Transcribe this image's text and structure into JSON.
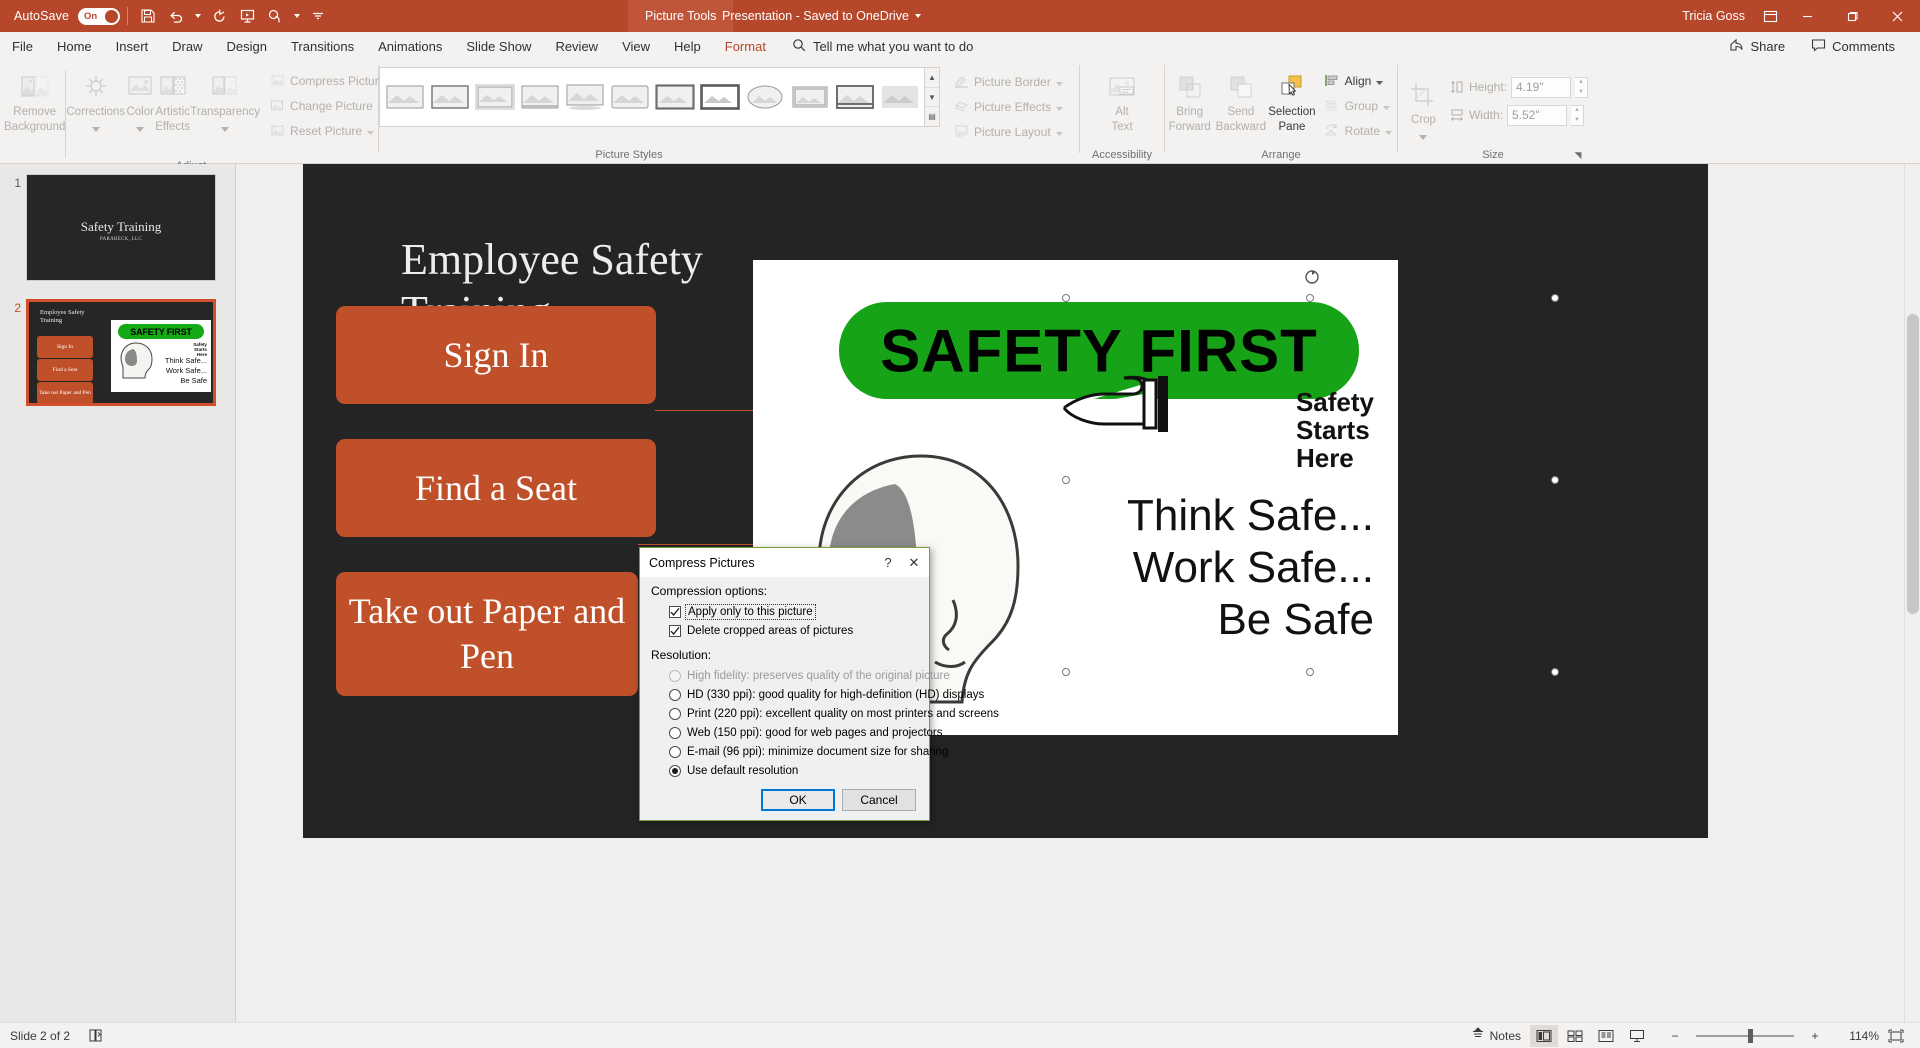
{
  "titlebar": {
    "autosave_label": "AutoSave",
    "autosave_state": "On",
    "qat_icons": [
      "save-icon",
      "undo-icon",
      "redo-icon",
      "start-presentation-icon",
      "touch-mode-icon"
    ],
    "context_tab": "Picture Tools",
    "doc_title": "Presentation  -  Saved to OneDrive",
    "user_name": "Tricia Goss",
    "window_buttons": [
      "minimize",
      "restore",
      "close"
    ]
  },
  "tabs": [
    {
      "label": "File",
      "active": false
    },
    {
      "label": "Home",
      "active": false
    },
    {
      "label": "Insert",
      "active": false
    },
    {
      "label": "Draw",
      "active": false
    },
    {
      "label": "Design",
      "active": false
    },
    {
      "label": "Transitions",
      "active": false
    },
    {
      "label": "Animations",
      "active": false
    },
    {
      "label": "Slide Show",
      "active": false
    },
    {
      "label": "Review",
      "active": false
    },
    {
      "label": "View",
      "active": false
    },
    {
      "label": "Help",
      "active": false
    },
    {
      "label": "Format",
      "active": true
    }
  ],
  "tellme": {
    "placeholder": "Tell me what you want to do"
  },
  "share": {
    "share_label": "Share",
    "comments_label": "Comments"
  },
  "ribbon": {
    "groups": [
      {
        "name": "Adjust",
        "label": "Adjust"
      },
      {
        "name": "Picture Styles",
        "label": "Picture Styles"
      },
      {
        "name": "Accessibility",
        "label": "Accessibility"
      },
      {
        "name": "Arrange",
        "label": "Arrange"
      },
      {
        "name": "Size",
        "label": "Size"
      }
    ],
    "adjust": {
      "remove_background": "Remove\nBackground",
      "remove_background_l1": "Remove",
      "remove_background_l2": "Background",
      "corrections": "Corrections",
      "color": "Color",
      "artistic_effects_l1": "Artistic",
      "artistic_effects_l2": "Effects",
      "transparency": "Transparency",
      "compress_pictures": "Compress Pictures",
      "change_picture": "Change Picture",
      "reset_picture": "Reset Picture"
    },
    "picture_styles": {
      "border": "Picture Border",
      "effects": "Picture Effects",
      "layout": "Picture Layout"
    },
    "accessibility": {
      "alt_text_l1": "Alt",
      "alt_text_l2": "Text"
    },
    "arrange": {
      "bring_forward_l1": "Bring",
      "bring_forward_l2": "Forward",
      "send_backward_l1": "Send",
      "send_backward_l2": "Backward",
      "selection_pane_l1": "Selection",
      "selection_pane_l2": "Pane",
      "align": "Align",
      "group": "Group",
      "rotate": "Rotate"
    },
    "size": {
      "crop": "Crop",
      "height_label": "Height:",
      "height_value": "4.19\"",
      "width_label": "Width:",
      "width_value": "5.52\""
    }
  },
  "thumbnails": [
    {
      "number": "1",
      "selected": false,
      "title": "Safety Training",
      "subtitle": "PARABECK, LLC"
    },
    {
      "number": "2",
      "selected": true,
      "heading": "Employee Safety Training",
      "boxes": [
        "Sign In",
        "Find a Seat",
        "Take out Paper and Pen"
      ],
      "banner": "SAFETY FIRST",
      "starts_here": "Safety\nStarts\nHere",
      "lines": [
        "Think Safe...",
        "Work Safe...",
        "Be Safe"
      ]
    }
  ],
  "slide": {
    "title": "Employee Safety Training",
    "boxes": [
      {
        "label": "Sign In"
      },
      {
        "label": "Find a Seat"
      },
      {
        "label": "Take out Paper and Pen"
      }
    ],
    "picture": {
      "banner": "SAFETY FIRST",
      "starts_here_lines": [
        "Safety",
        "Starts",
        "Here"
      ],
      "body_lines": [
        "Think Safe...",
        "Work Safe...",
        "Be Safe"
      ]
    }
  },
  "dialog": {
    "title": "Compress Pictures",
    "help_glyph": "?",
    "close_glyph": "✕",
    "compression_options_label": "Compression options:",
    "checkboxes": [
      {
        "label": "Apply only to this picture",
        "accel": "A",
        "checked": true,
        "focused": true
      },
      {
        "label": "Delete cropped areas of pictures",
        "accel": "D",
        "checked": true,
        "focused": false
      }
    ],
    "resolution_label": "Resolution:",
    "radios": [
      {
        "label": "High fidelity: preserves quality of the original picture",
        "accel": "f",
        "selected": false,
        "disabled": true
      },
      {
        "label": "HD (330 ppi): good quality for high-definition (HD) displays",
        "accel": "HD",
        "selected": false,
        "disabled": false
      },
      {
        "label": "Print (220 ppi): excellent quality on most printers and screens",
        "accel": "P",
        "selected": false,
        "disabled": false
      },
      {
        "label": "Web (150 ppi): good for web pages and projectors",
        "accel": "W",
        "selected": false,
        "disabled": false
      },
      {
        "label": "E-mail (96 ppi): minimize document size for sharing",
        "accel": "E",
        "selected": false,
        "disabled": false
      },
      {
        "label": "Use default resolution",
        "accel": "U",
        "selected": true,
        "disabled": false
      }
    ],
    "ok_label": "OK",
    "cancel_label": "Cancel"
  },
  "statusbar": {
    "slide_count": "Slide 2 of 2",
    "accessibility_icon": "accessibility-checker-icon",
    "notes_label": "Notes",
    "view_buttons": [
      "normal-view-icon",
      "slide-sorter-icon",
      "reading-view-icon",
      "slideshow-icon"
    ],
    "zoom_out": "−",
    "zoom_in": "+",
    "zoom_level": "114%",
    "fit_icon": "fit-slide-icon"
  },
  "colors": {
    "accent": "#b7472a",
    "box_orange": "#c0502a",
    "banner_green": "#17a317",
    "slide_bg": "#242424",
    "dialog_border": "#7a9c3f",
    "default_button": "#0078d7"
  }
}
